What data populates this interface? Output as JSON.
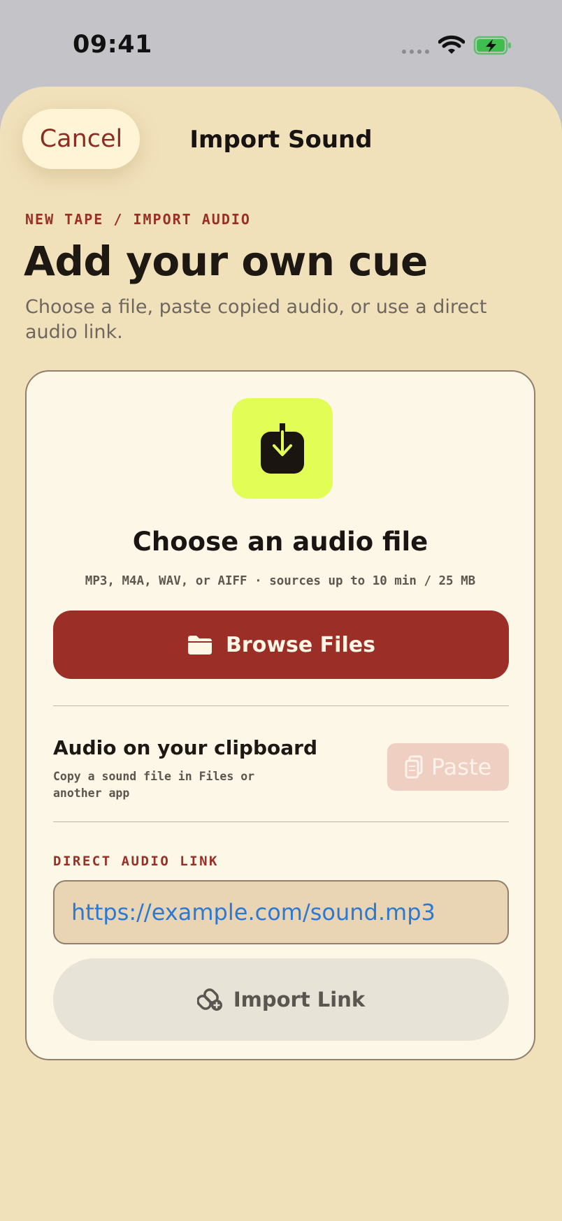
{
  "status_bar": {
    "time": "09:41"
  },
  "header": {
    "cancel_label": "Cancel",
    "title": "Import Sound"
  },
  "intro": {
    "eyebrow": "NEW TAPE / IMPORT AUDIO",
    "headline": "Add your own cue",
    "subtitle": "Choose a file, paste copied audio, or use a direct audio link."
  },
  "file_section": {
    "heading": "Choose an audio file",
    "formats": "MP3, M4A, WAV, or AIFF · sources up to 10 min / 25 MB",
    "browse_label": "Browse Files"
  },
  "clipboard_section": {
    "title": "Audio on your clipboard",
    "description": "Copy a sound file in Files or another app",
    "paste_label": "Paste"
  },
  "link_section": {
    "label": "DIRECT AUDIO LINK",
    "url_value": "https://example.com/sound.mp3",
    "import_label": "Import Link"
  },
  "icons": {
    "upload": "download-tray-icon",
    "browse": "folder-icon",
    "paste": "clipboard-icon",
    "import_link": "link-plus-icon"
  },
  "colors": {
    "sheet_background": "#f1e1bb",
    "card_background": "#fdf7e7",
    "accent_red": "#9b2f28",
    "upload_tile": "#e2fd55",
    "link_text": "#2c79d4",
    "paste_disabled": "#efcfc2"
  }
}
